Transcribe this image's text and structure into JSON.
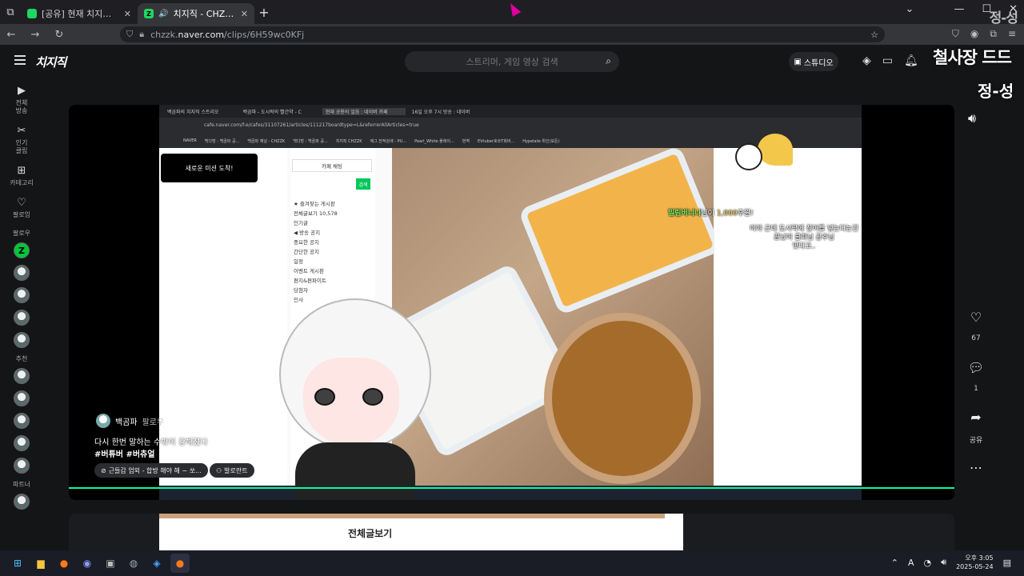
{
  "browser": {
    "tabs": [
      {
        "label": "[공유] 현재 치지직에 가장 핫한",
        "active": false
      },
      {
        "label": "치지직 - CHZZK",
        "active": true
      }
    ],
    "url_prefix": "chzzk.",
    "url_domain": "naver.com",
    "url_path": "/clips/6H59wc0KFj",
    "overlay_corner": "정-성"
  },
  "header": {
    "logo": "치지직",
    "search_placeholder": "스트리머, 게임 영상 검색",
    "studio_label": "스튜디오",
    "overlay_big": "철사장 드드",
    "overlay_jung": "정-성"
  },
  "sidebar": {
    "nav": [
      {
        "icon": "video-icon",
        "label": "전체\n방송"
      },
      {
        "icon": "branch-icon",
        "label": "인기\n클립"
      },
      {
        "icon": "grid-icon",
        "label": "카테고리"
      },
      {
        "icon": "heart-icon",
        "label": "팔로잉"
      }
    ],
    "sections": {
      "following": "팔로우",
      "recommended": "추천",
      "partner": "파트너"
    },
    "badge_count": "N"
  },
  "clip": {
    "inner_tabs": [
      "백곰파의 치지직 스트리오",
      "백곰파 - 도시락의 빨간약 - C",
      "현재 공용의 얼음 : 네이버 카페",
      "16일 오후 7시 방송 : 네이버"
    ],
    "inner_url": "cafe.naver.com/f-e/cafes/31107261/articles/111217boardtype=L&referrerAllArticles=true",
    "inner_bookmarks": [
      "NAVER",
      "백다방 : 백곰파 공...",
      "백곰파 채널 - CHZZK",
      "백다방 : 백곰파 공...",
      "치지직 CHZZK",
      "애그 전적검색 - PU...",
      "Pearl_White 플레이...",
      "번역",
      "EVtuber호쏘T회비...",
      "Hypelate 위인(모든)"
    ],
    "ad_button": "새로운 미션 도착!",
    "cafe_chat": "카페 채팅",
    "cafe_search_btn": "검색",
    "cafe_menu": [
      "★ 즐겨찾는 게시판",
      "전체글보기   10,578",
      "인기글",
      "◀ 방송 공지",
      "중요한 공지",
      "간단한 공지",
      "일정",
      "이벤트 게시판",
      "편지&편파이트",
      "당첨자",
      "인사"
    ],
    "donation_name": "밀림버니나",
    "donation_text": "님이",
    "donation_amount": "1,000",
    "donation_suffix": "후원!",
    "donation_message": "이야 근데 도시락에 장어를 넣는다는건 끝났어 쿨파님 공주님",
    "donation_message2": "맛다고..",
    "channel_name": "백곰파",
    "follow_label": "팔로우",
    "description": "다시 한번 말하는 수밖이 강해졌다",
    "tags": "#버튜버 #버츄얼",
    "chips": [
      "근들갑 엄외 - 합방 해야 해 ~ 쏘...",
      "발로란트"
    ],
    "progress": 1.0
  },
  "actions": {
    "like_count": "67",
    "comment_count": "1",
    "share_label": "공유"
  },
  "next_clip": {
    "title": "전체글보기"
  },
  "taskbar": {
    "time": "오후 3:05",
    "date": "2025-05-24",
    "ime": "A"
  },
  "colors": {
    "accent": "#00ffa3",
    "naver_green": "#03c75a",
    "chzzk_green": "#00c73c"
  }
}
